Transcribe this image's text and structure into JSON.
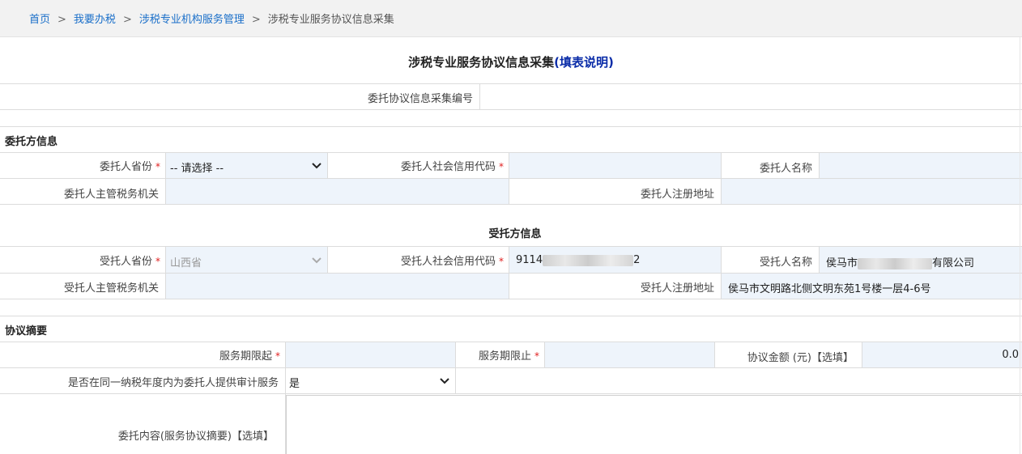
{
  "breadcrumb": {
    "items": [
      "首页",
      "我要办税",
      "涉税专业机构服务管理"
    ],
    "current": "涉税专业服务协议信息采集",
    "separator": ">"
  },
  "page": {
    "title": "涉税专业服务协议信息采集",
    "help_link": "(填表说明)"
  },
  "agreement_no": {
    "label": "委托协议信息采集编号",
    "value": ""
  },
  "client": {
    "section_title": "委托方信息",
    "province_label": "委托人省份",
    "province_value": "-- 请选择 --",
    "credit_code_label": "委托人社会信用代码",
    "credit_code_value": "",
    "name_label": "委托人名称",
    "name_value": "",
    "tax_authority_label": "委托人主管税务机关",
    "tax_authority_value": "",
    "address_label": "委托人注册地址",
    "address_value": ""
  },
  "trustee": {
    "section_title": "受托方信息",
    "province_label": "受托人省份",
    "province_value": "山西省",
    "credit_code_label": "受托人社会信用代码",
    "credit_code_prefix": "9114",
    "credit_code_suffix": "2",
    "name_label": "受托人名称",
    "name_prefix": "侯马市",
    "name_suffix": "有限公司",
    "tax_authority_label": "受托人主管税务机关",
    "tax_authority_value": "",
    "address_label": "受托人注册地址",
    "address_value": "侯马市文明路北侧文明东苑1号楼一层4-6号"
  },
  "summary": {
    "section_title": "协议摘要",
    "start_label": "服务期限起",
    "start_value": "",
    "end_label": "服务期限止",
    "end_value": "",
    "amount_label": "协议金额 (元)【选填】",
    "amount_value": "0.0",
    "audit_label": "是否在同一纳税年度内为委托人提供审计服务",
    "audit_value": "是",
    "content_label": "委托内容(服务协议摘要)【选填】",
    "content_value": ""
  },
  "required_mark": "*",
  "colors": {
    "link": "#1a6fc9",
    "help_link": "#0a2ca8",
    "required": "#e02020",
    "field_bg": "#eef4fb"
  },
  "icons": {
    "select_arrow": "chevron-down-icon"
  }
}
